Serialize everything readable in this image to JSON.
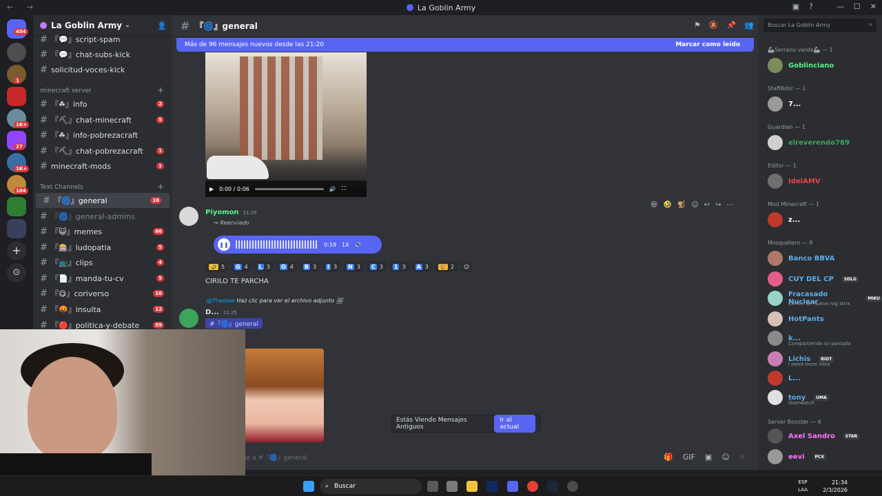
{
  "window": {
    "title": "La Goblin Army"
  },
  "server": {
    "name": "La Goblin Army"
  },
  "rail": {
    "badges": [
      "454",
      "1",
      "1K+",
      "27",
      "1K+",
      "104"
    ]
  },
  "channels": {
    "top_items": [
      {
        "label": "『💬』script-spam",
        "count": ""
      },
      {
        "label": "『💬』chat-subs-kick",
        "count": ""
      },
      {
        "label": "solicitud-voces-kick",
        "count": ""
      }
    ],
    "category_minecraft": "minecraft server",
    "minecraft_items": [
      {
        "label": "『☘』info",
        "count": "2"
      },
      {
        "label": "『⛏』chat-minecraft",
        "count": "5"
      },
      {
        "label": "『☘』info-pobrezacraft",
        "count": ""
      },
      {
        "label": "『⛏』chat-pobrezacraft",
        "count": "1"
      },
      {
        "label": "minecraft-mods",
        "count": "1"
      }
    ],
    "category_text": "Text Channels",
    "text_items": [
      {
        "label": "『🌀』general",
        "count": "18"
      },
      {
        "label": "『🌀』general-admins",
        "count": ""
      },
      {
        "label": "『😺』memes",
        "count": "66"
      },
      {
        "label": "『🎰』ludopatia",
        "count": "5"
      },
      {
        "label": "『📺』clips",
        "count": "4"
      },
      {
        "label": "『📄』manda-tu-cv",
        "count": "5"
      },
      {
        "label": "『😋』coriverso",
        "count": "10"
      },
      {
        "label": "『🤬』insulta",
        "count": "12"
      },
      {
        "label": "『🔴』politica-y-debate",
        "count": "59"
      }
    ]
  },
  "main": {
    "channel_title": "『🌀』general",
    "new_messages_bar": "Más de 96 mensajes nuevos desde las 21:20",
    "mark_read": "Marcar como leído",
    "video": {
      "time": "0:00 / 0:06"
    },
    "msg1": {
      "author": "Piyomon",
      "time": "21:25",
      "forwarded": "Reenviado",
      "voice_duration": "0:19",
      "voice_speed": "1X"
    },
    "reactions": [
      {
        "emoji": "🤣",
        "count": "5",
        "yellow": true
      },
      {
        "emoji": "G",
        "count": "4"
      },
      {
        "emoji": "L",
        "count": "3"
      },
      {
        "emoji": "O",
        "count": "4"
      },
      {
        "emoji": "B",
        "count": "3"
      },
      {
        "emoji": "I",
        "count": "3"
      },
      {
        "emoji": "N",
        "count": "3"
      },
      {
        "emoji": "C",
        "count": "3"
      },
      {
        "emoji": "1",
        "count": "3"
      },
      {
        "emoji": "A",
        "count": "3"
      },
      {
        "emoji": "🐒",
        "count": "2",
        "yellow": true
      }
    ],
    "msg2_text": "CIRILO TE PARCHA",
    "reply": {
      "mention": "@Theslow",
      "text": "Haz clic para ver el archivo adjunto"
    },
    "msg3": {
      "author": "D...",
      "time": "21:25",
      "link": "#『🌀』general"
    },
    "old_messages": {
      "text": "Estás Viendo Mensajes Antiguos",
      "jump": "Ir al actual"
    },
    "composer_placeholder": "aje a #『🌀』general"
  },
  "members": {
    "search_placeholder": "Buscar La Goblin Army",
    "groups": [
      {
        "role": "🦾Serrano verde🦾 — 1",
        "members": [
          {
            "name": "Goblinciano",
            "color": "#57f287",
            "sub": "",
            "tag": ""
          }
        ]
      },
      {
        "role": "StaffAdor — 1",
        "members": [
          {
            "name": "7...",
            "color": "#ffffff",
            "sub": "",
            "tag": ""
          }
        ]
      },
      {
        "role": "Guardian — 1",
        "members": [
          {
            "name": "elreverendo789",
            "color": "#3ba55d",
            "sub": "",
            "tag": ""
          }
        ]
      },
      {
        "role": "Editor — 1",
        "members": [
          {
            "name": "IdelAMV",
            "color": "#ed4245",
            "sub": "",
            "tag": ""
          }
        ]
      },
      {
        "role": "Mod Minecraft — 1",
        "members": [
          {
            "name": "z...",
            "color": "#ffffff",
            "sub": "",
            "tag": ""
          }
        ]
      },
      {
        "role": "Mosquetero — 8",
        "members": [
          {
            "name": "Banco BBVA",
            "color": "#5dadec",
            "sub": "",
            "tag": ""
          },
          {
            "name": "CUY DEL CP",
            "color": "#5dadec",
            "sub": "",
            "tag": "SDLG"
          },
          {
            "name": "Fracasado Nuclear",
            "color": "#5dadec",
            "sub": "Carton de huevo rog strix",
            "tag": "MIKU"
          },
          {
            "name": "HotPants",
            "color": "#5dadec",
            "sub": "",
            "tag": ""
          },
          {
            "name": "k...",
            "color": "#5dadec",
            "sub": "Compartiendo su pantalla",
            "tag": ""
          },
          {
            "name": "Lichis",
            "color": "#5dadec",
            "sub": "I need more nitro",
            "tag": "RIOT"
          },
          {
            "name": "L...",
            "color": "#5dadec",
            "sub": "",
            "tag": ""
          },
          {
            "name": "tony",
            "color": "#5dadec",
            "sub": "Overwatch",
            "tag": "UMA"
          }
        ]
      },
      {
        "role": "Server Booster — 6",
        "members": [
          {
            "name": "Axel Sandro",
            "color": "#ff73fa",
            "sub": "",
            "tag": "STAR"
          },
          {
            "name": "eevi",
            "color": "#ff73fa",
            "sub": "",
            "tag": "PCX"
          }
        ]
      }
    ]
  },
  "taskbar": {
    "search_label": "Buscar",
    "lang": "ESP",
    "lang2": "LAA",
    "time": "21:34",
    "date": "2/3/2026"
  }
}
